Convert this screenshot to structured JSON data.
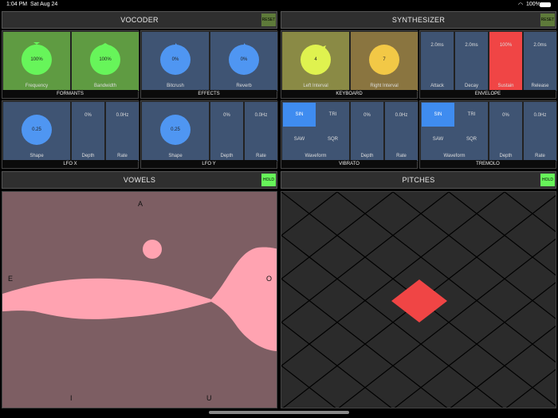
{
  "status": {
    "time": "1:04 PM",
    "date": "Sat Aug 24",
    "battery": "100%"
  },
  "vocoder": {
    "title": "VOCODER",
    "reset": "RESET",
    "formants": {
      "label": "FORMANTS",
      "freq_val": "100%",
      "freq_label": "Frequency",
      "bw_val": "100%",
      "bw_label": "Bandwidth"
    },
    "effects": {
      "label": "EFFECTS",
      "bit_val": "0%",
      "bit_label": "Bitcrush",
      "rev_val": "0%",
      "rev_label": "Reverb"
    },
    "lfox": {
      "label": "LFO X",
      "shape_val": "0.25",
      "shape_label": "Shape",
      "depth_val": "0%",
      "depth_label": "Depth",
      "rate_val": "0.0Hz",
      "rate_label": "Rate"
    },
    "lfoy": {
      "label": "LFO Y",
      "shape_val": "0.25",
      "shape_label": "Shape",
      "depth_val": "0%",
      "depth_label": "Depth",
      "rate_val": "0.0Hz",
      "rate_label": "Rate"
    }
  },
  "synth": {
    "title": "SYNTHESIZER",
    "reset": "RESET",
    "keyboard": {
      "label": "KEYBOARD",
      "left_val": "4",
      "left_label": "Left Interval",
      "right_val": "7",
      "right_label": "Right Interval"
    },
    "envelope": {
      "label": "ENVELOPE",
      "attack_val": "2.0ms",
      "attack_label": "Attack",
      "decay_val": "2.0ms",
      "decay_label": "Decay",
      "sustain_val": "100%",
      "sustain_label": "Sustain",
      "release_val": "2.0ms",
      "release_label": "Release"
    },
    "vibrato": {
      "label": "VIBRATO",
      "sin": "SIN",
      "tri": "TRI",
      "saw": "SAW",
      "sqr": "SQR",
      "waveform_label": "Waveform",
      "depth_val": "0%",
      "depth_label": "Depth",
      "rate_val": "0.0Hz",
      "rate_label": "Rate"
    },
    "tremolo": {
      "label": "TREMOLO",
      "sin": "SIN",
      "tri": "TRI",
      "saw": "SAW",
      "sqr": "SQR",
      "waveform_label": "Waveform",
      "depth_val": "0%",
      "depth_label": "Depth",
      "rate_val": "0.0Hz",
      "rate_label": "Rate"
    }
  },
  "vowels": {
    "title": "VOWELS",
    "hold": "HOLD",
    "a": "A",
    "e": "E",
    "o": "O",
    "i": "I",
    "u": "U"
  },
  "pitches": {
    "title": "PITCHES",
    "hold": "HOLD"
  },
  "colors": {
    "accent_green": "#67f55a",
    "sustain_red": "#f04545",
    "pink": "#ffa3b1",
    "selected_wave": "#3f8cf0"
  }
}
